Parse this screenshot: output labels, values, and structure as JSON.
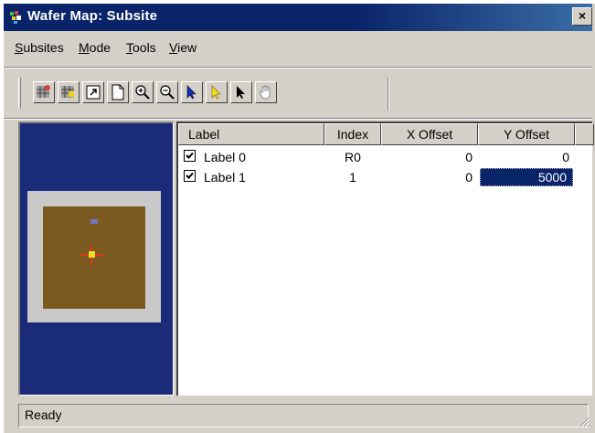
{
  "window": {
    "title": "Wafer Map: Subsite",
    "close_label": "×"
  },
  "menu": [
    {
      "label": "Subsites"
    },
    {
      "label": "Mode"
    },
    {
      "label": "Tools"
    },
    {
      "label": "View"
    }
  ],
  "toolbar": {
    "buttons": [
      {
        "icon": "die-grid-add-icon"
      },
      {
        "icon": "die-grid-remove-icon"
      },
      {
        "icon": "export-icon"
      },
      {
        "icon": "new-page-icon"
      },
      {
        "icon": "zoom-in-icon"
      },
      {
        "icon": "zoom-out-icon"
      },
      {
        "icon": "select-arrow-icon"
      },
      {
        "icon": "yellow-pointer-icon"
      },
      {
        "icon": "black-pointer-icon"
      },
      {
        "icon": "pan-hand-icon"
      }
    ]
  },
  "table": {
    "columns": [
      "Label",
      "Index",
      "X Offset",
      "Y Offset"
    ],
    "rows": [
      {
        "checked": true,
        "label": "Label 0",
        "index": "R0",
        "x_offset": "0",
        "y_offset": "0"
      },
      {
        "checked": true,
        "label": "Label 1",
        "index": "1",
        "x_offset": "0",
        "y_offset": "5000"
      }
    ],
    "selected_cell": {
      "row": 1,
      "column": "Y Offset"
    }
  },
  "status": {
    "text": "Ready"
  },
  "colors": {
    "title_bar": "#0a246a",
    "preview_background": "#1a2b7a",
    "die": "#7a5a1f",
    "die_frame": "#c9c9c9",
    "selection": "#0a246a"
  }
}
